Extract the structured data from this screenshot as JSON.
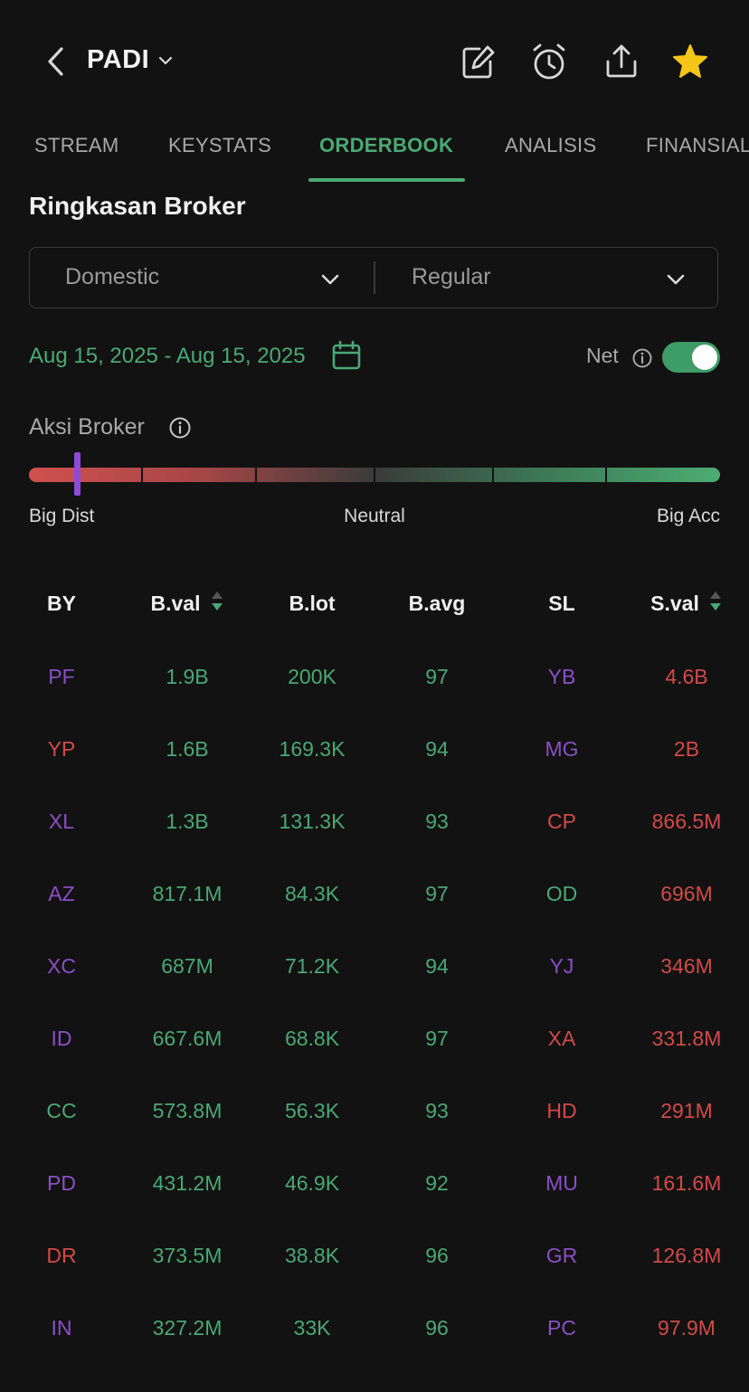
{
  "header": {
    "ticker": "PADI",
    "icons": [
      "back-arrow-icon",
      "chevron-down-icon",
      "edit-icon",
      "alarm-icon",
      "share-icon",
      "star-icon"
    ]
  },
  "tabs": [
    {
      "label": "STREAM",
      "active": false
    },
    {
      "label": "KEYSTATS",
      "active": false
    },
    {
      "label": "ORDERBOOK",
      "active": true
    },
    {
      "label": "ANALISIS",
      "active": false
    },
    {
      "label": "FINANSIAL",
      "active": false
    }
  ],
  "summary": {
    "title": "Ringkasan Broker",
    "filter_market": "Domestic",
    "filter_board": "Regular",
    "date_range": "Aug 15, 2025 - Aug 15, 2025",
    "net_label": "Net",
    "net_enabled": true
  },
  "broker_action": {
    "label": "Aksi Broker",
    "left_label": "Big Dist",
    "center_label": "Neutral",
    "right_label": "Big Acc",
    "position_fraction": 0.07
  },
  "table": {
    "headers": {
      "by": "BY",
      "bval": "B.val",
      "blot": "B.lot",
      "bavg": "B.avg",
      "sl": "SL",
      "sval": "S.val"
    },
    "rows": [
      {
        "by": "PF",
        "by_color": "purple",
        "bval": "1.9B",
        "blot": "200K",
        "bavg": "97",
        "sl": "YB",
        "sl_color": "purple",
        "sval": "4.6B"
      },
      {
        "by": "YP",
        "by_color": "red",
        "bval": "1.6B",
        "blot": "169.3K",
        "bavg": "94",
        "sl": "MG",
        "sl_color": "purple",
        "sval": "2B"
      },
      {
        "by": "XL",
        "by_color": "purple",
        "bval": "1.3B",
        "blot": "131.3K",
        "bavg": "93",
        "sl": "CP",
        "sl_color": "red",
        "sval": "866.5M"
      },
      {
        "by": "AZ",
        "by_color": "purple",
        "bval": "817.1M",
        "blot": "84.3K",
        "bavg": "97",
        "sl": "OD",
        "sl_color": "green",
        "sval": "696M"
      },
      {
        "by": "XC",
        "by_color": "purple",
        "bval": "687M",
        "blot": "71.2K",
        "bavg": "94",
        "sl": "YJ",
        "sl_color": "purple",
        "sval": "346M"
      },
      {
        "by": "ID",
        "by_color": "purple",
        "bval": "667.6M",
        "blot": "68.8K",
        "bavg": "97",
        "sl": "XA",
        "sl_color": "red",
        "sval": "331.8M"
      },
      {
        "by": "CC",
        "by_color": "green",
        "bval": "573.8M",
        "blot": "56.3K",
        "bavg": "93",
        "sl": "HD",
        "sl_color": "red",
        "sval": "291M"
      },
      {
        "by": "PD",
        "by_color": "purple",
        "bval": "431.2M",
        "blot": "46.9K",
        "bavg": "92",
        "sl": "MU",
        "sl_color": "purple",
        "sval": "161.6M"
      },
      {
        "by": "DR",
        "by_color": "red",
        "bval": "373.5M",
        "blot": "38.8K",
        "bavg": "96",
        "sl": "GR",
        "sl_color": "purple",
        "sval": "126.8M"
      },
      {
        "by": "IN",
        "by_color": "purple",
        "bval": "327.2M",
        "blot": "33K",
        "bavg": "96",
        "sl": "PC",
        "sl_color": "purple",
        "sval": "97.9M"
      }
    ]
  },
  "colors": {
    "accent_green": "#4aa874",
    "sell_red": "#d14a48",
    "broker_purple": "#8a4fc5",
    "background": "#121212",
    "star_yellow": "#f5c518"
  }
}
